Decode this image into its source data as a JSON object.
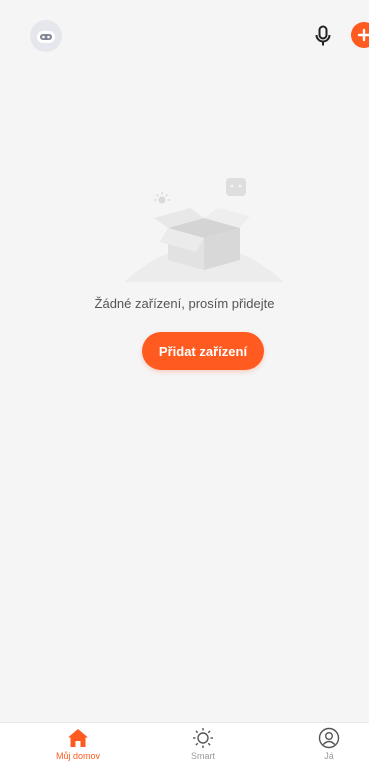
{
  "colors": {
    "accent": "#ff5a1f",
    "background": "#f5f5f5",
    "inactive": "#9a9a9a"
  },
  "header": {
    "avatar_icon": "robot-avatar-icon",
    "mic_icon": "microphone-icon",
    "add_icon": "plus-icon"
  },
  "empty_state": {
    "message": "Žádné zařízení, prosím přidejte",
    "button_label": "Přidat zařízení"
  },
  "bottom_nav": {
    "items": [
      {
        "label": "Můj domov",
        "icon": "home-icon",
        "active": true
      },
      {
        "label": "Smart",
        "icon": "sun-icon",
        "active": false
      },
      {
        "label": "Já",
        "icon": "user-icon",
        "active": false
      }
    ]
  }
}
